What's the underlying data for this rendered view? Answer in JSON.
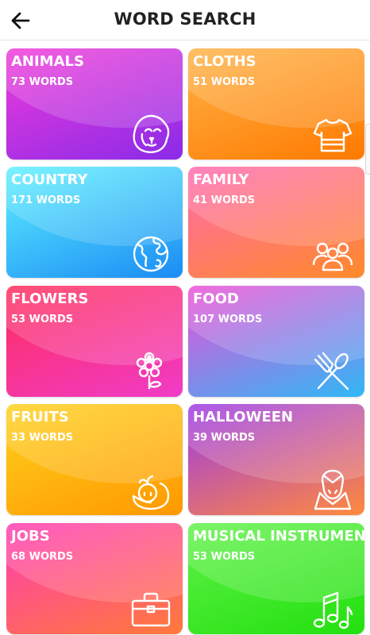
{
  "header": {
    "title": "WORD SEARCH",
    "back_icon": "arrow-left-icon"
  },
  "categories": [
    {
      "name": "ANIMALS",
      "count": "73 WORDS",
      "icon": "lion-icon",
      "colors": [
        "#f23bd9",
        "#8a2be8"
      ]
    },
    {
      "name": "CLOTHS",
      "count": "51 WORDS",
      "icon": "tshirt-icon",
      "colors": [
        "#ffb347",
        "#ff7a00"
      ]
    },
    {
      "name": "COUNTRY",
      "count": "171 WORDS",
      "icon": "globe-icon",
      "colors": [
        "#5ff2ff",
        "#1b8cf5"
      ]
    },
    {
      "name": "FAMILY",
      "count": "41 WORDS",
      "icon": "family-icon",
      "colors": [
        "#ff6ab0",
        "#ff8a2a"
      ]
    },
    {
      "name": "FLOWERS",
      "count": "53 WORDS",
      "icon": "flower-icon",
      "colors": [
        "#ff2d5a",
        "#f03cc8"
      ]
    },
    {
      "name": "FOOD",
      "count": "107 WORDS",
      "icon": "fork-spoon-icon",
      "colors": [
        "#ee4fd6",
        "#2fb8f6"
      ]
    },
    {
      "name": "FRUITS",
      "count": "33 WORDS",
      "icon": "fruit-bowl-icon",
      "colors": [
        "#ffd21f",
        "#ff9800"
      ]
    },
    {
      "name": "HALLOWEEN",
      "count": "39 WORDS",
      "icon": "vampire-icon",
      "colors": [
        "#9b39e8",
        "#ff8a3d"
      ]
    },
    {
      "name": "JOBS",
      "count": "68 WORDS",
      "icon": "briefcase-icon",
      "colors": [
        "#ff3bb5",
        "#ff7a3a"
      ]
    },
    {
      "name": "MUSICAL INSTRUMENT",
      "count": "53 WORDS",
      "icon": "music-notes-icon",
      "colors": [
        "#62f24a",
        "#22e00e"
      ]
    }
  ]
}
